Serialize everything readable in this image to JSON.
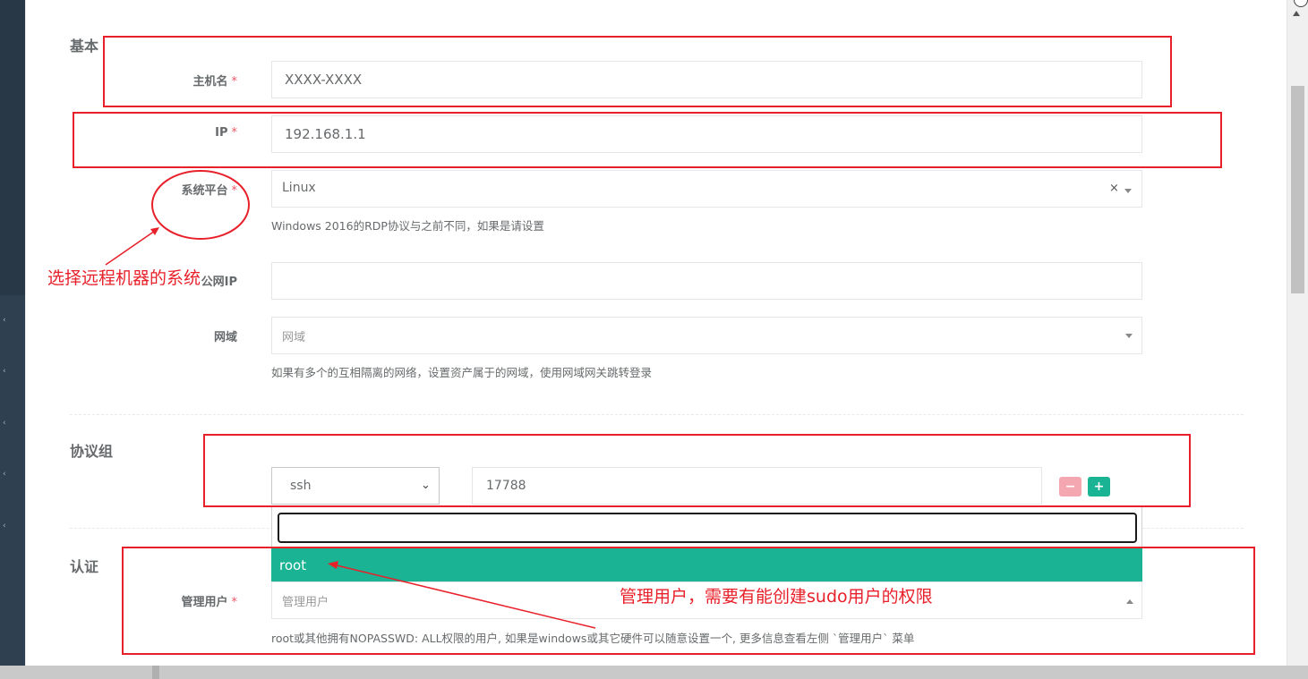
{
  "sections": {
    "basic": "基本",
    "protocols": "协议组",
    "auth": "认证"
  },
  "form": {
    "hostname": {
      "label": "主机名",
      "required": "*",
      "value": "XXXX-XXXX"
    },
    "ip": {
      "label": "IP",
      "required": "*",
      "value": "192.168.1.1"
    },
    "platform": {
      "label": "系统平台",
      "required": "*",
      "value": "Linux",
      "clear": "×",
      "help": "Windows 2016的RDP协议与之前不同，如果是请设置"
    },
    "public_ip": {
      "label": "公网IP",
      "value": ""
    },
    "domain": {
      "label": "网域",
      "placeholder": "网域",
      "help": "如果有多个的互相隔离的网络，设置资产属于的网域，使用网域网关跳转登录"
    },
    "protocol": {
      "type": "ssh",
      "port": "17788",
      "remove_symbol": "−",
      "add_symbol": "+"
    },
    "admin_user": {
      "label": "管理用户",
      "required": "*",
      "placeholder": "管理用户",
      "help": "root或其他拥有NOPASSWD: ALL权限的用户, 如果是windows或其它硬件可以随意设置一个, 更多信息查看左侧 `管理用户` 菜单",
      "dropdown_search": "",
      "options": [
        "root"
      ]
    }
  },
  "annotations": {
    "platform_note": "选择远程机器的系统",
    "admin_note": "管理用户，需要有能创建sudo用户的权限"
  },
  "colors": {
    "annotation": "#e8202a",
    "option_highlight": "#1ab394",
    "remove_button": "#f4a7b0",
    "add_button": "#1ab394",
    "sidebar": "#2f4050"
  }
}
